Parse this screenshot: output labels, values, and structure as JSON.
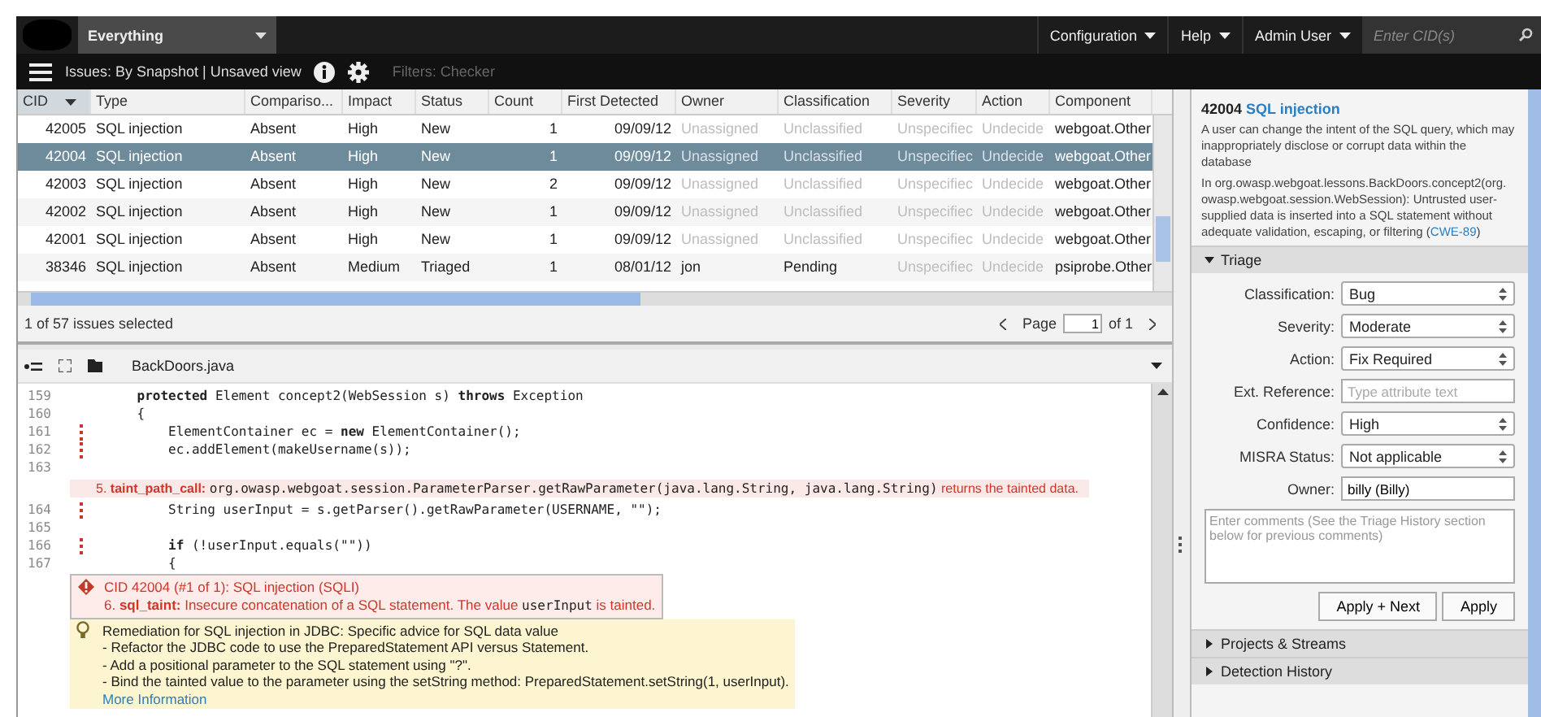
{
  "topbar": {
    "view": "Everything",
    "menus": [
      "Configuration",
      "Help",
      "Admin User"
    ],
    "search": {
      "placeholder": "Enter CID(s)"
    }
  },
  "toolbar": {
    "view_title": "Issues: By Snapshot | Unsaved view",
    "filters": "Filters: Checker"
  },
  "table": {
    "columns": [
      {
        "label": "CID",
        "sorted": true
      },
      {
        "label": "Type",
        "sorted": false
      },
      {
        "label": "Compariso...",
        "sorted": false
      },
      {
        "label": "Impact",
        "sorted": false
      },
      {
        "label": "Status",
        "sorted": false
      },
      {
        "label": "Count",
        "sorted": false
      },
      {
        "label": "First Detected",
        "sorted": false
      },
      {
        "label": "Owner",
        "sorted": false
      },
      {
        "label": "Classification",
        "sorted": false
      },
      {
        "label": "Severity",
        "sorted": false
      },
      {
        "label": "Action",
        "sorted": false
      },
      {
        "label": "Component",
        "sorted": false
      }
    ],
    "rows": [
      {
        "selected": false,
        "cells": [
          "42005",
          "SQL injection",
          "Absent",
          "High",
          "New",
          "1",
          "09/09/12",
          "Unassigned",
          "Unclassified",
          "Unspecifiec",
          "Undecide",
          "webgoat.Other"
        ],
        "dim": [
          false,
          false,
          false,
          false,
          false,
          false,
          false,
          true,
          true,
          true,
          true,
          false
        ]
      },
      {
        "selected": true,
        "cells": [
          "42004",
          "SQL injection",
          "Absent",
          "High",
          "New",
          "1",
          "09/09/12",
          "Unassigned",
          "Unclassified",
          "Unspecifiec",
          "Undecide",
          "webgoat.Other"
        ],
        "dim": [
          false,
          false,
          false,
          false,
          false,
          false,
          false,
          true,
          true,
          true,
          true,
          false
        ]
      },
      {
        "selected": false,
        "cells": [
          "42003",
          "SQL injection",
          "Absent",
          "High",
          "New",
          "2",
          "09/09/12",
          "Unassigned",
          "Unclassified",
          "Unspecifiec",
          "Undecide",
          "webgoat.Other"
        ],
        "dim": [
          false,
          false,
          false,
          false,
          false,
          false,
          false,
          true,
          true,
          true,
          true,
          false
        ]
      },
      {
        "selected": false,
        "cells": [
          "42002",
          "SQL injection",
          "Absent",
          "High",
          "New",
          "1",
          "09/09/12",
          "Unassigned",
          "Unclassified",
          "Unspecifiec",
          "Undecide",
          "webgoat.Other"
        ],
        "dim": [
          false,
          false,
          false,
          false,
          false,
          false,
          false,
          true,
          true,
          true,
          true,
          false
        ]
      },
      {
        "selected": false,
        "cells": [
          "42001",
          "SQL injection",
          "Absent",
          "High",
          "New",
          "1",
          "09/09/12",
          "Unassigned",
          "Unclassified",
          "Unspecifiec",
          "Undecide",
          "webgoat.Other"
        ],
        "dim": [
          false,
          false,
          false,
          false,
          false,
          false,
          false,
          true,
          true,
          true,
          true,
          false
        ]
      },
      {
        "selected": false,
        "cells": [
          "38346",
          "SQL injection",
          "Absent",
          "Medium",
          "Triaged",
          "1",
          "08/01/12",
          "jon",
          "Pending",
          "Unspecifiec",
          "Undecide",
          "psiprobe.Other"
        ],
        "dim": [
          false,
          false,
          false,
          false,
          false,
          false,
          false,
          false,
          false,
          true,
          true,
          false
        ]
      }
    ],
    "selection_status": "1 of 57 issues selected",
    "pager": {
      "label": "Page",
      "value": "1",
      "of": "of 1"
    }
  },
  "source": {
    "file": "BackDoors.java",
    "items": [
      {
        "kind": "line",
        "number": "159",
        "marked": false,
        "code": "    **protected** Element concept2(WebSession s) **throws** Exception"
      },
      {
        "kind": "line",
        "number": "160",
        "marked": false,
        "code": "    {"
      },
      {
        "kind": "line",
        "number": "161",
        "marked": true,
        "code": "        ElementContainer ec = **new** ElementContainer();"
      },
      {
        "kind": "line",
        "number": "162",
        "marked": true,
        "code": "        ec.addElement(makeUsername(s));"
      },
      {
        "kind": "line",
        "number": "163",
        "marked": false
      },
      {
        "kind": "event",
        "step": "5.",
        "tag": "taint_path_call:",
        "code": "org.owasp.webgoat.session.ParameterParser.getRawParameter(java.lang.String, java.lang.String)",
        "tail": "returns the tainted data."
      },
      {
        "kind": "line",
        "number": "164",
        "marked": true,
        "code": "        String userInput = s.getParser().getRawParameter(USERNAME, \"\");"
      },
      {
        "kind": "line",
        "number": "165",
        "marked": false
      },
      {
        "kind": "line",
        "number": "166",
        "marked": true,
        "code": "        **if** (!userInput.equals(\"\"))"
      },
      {
        "kind": "line",
        "number": "167",
        "marked": false,
        "code": "        {"
      },
      {
        "kind": "issue",
        "title": "CID 42004 (#1 of 1): SQL injection (SQLI)",
        "step": "6.",
        "tag": "sql_taint:",
        "text": "Insecure concatenation of a SQL statement. The value",
        "code": "userInput",
        "tail": "is tainted."
      },
      {
        "kind": "remedy",
        "title": "Remediation for SQL injection in JDBC: Specific advice for SQL data value",
        "lines": [
          "- Refactor the JDBC code to use the PreparedStatement API versus Statement.",
          "- Add a positional parameter to the SQL statement using \"?\".",
          "- Bind the tainted value to the parameter using the setString method: PreparedStatement.setString(1, userInput)."
        ],
        "link": "More Information"
      }
    ]
  },
  "details": {
    "cid": "42004",
    "type": "SQL injection",
    "description": "A user can change the intent of the SQL query, which may inappropriately disclose or corrupt data within the database",
    "detail": "In org.owasp.webgoat.lessons.BackDoors.concept2(org. owasp.webgoat.session.WebSession): Untrusted user-supplied data is inserted into a SQL statement without adequate validation, escaping, or filtering (",
    "cwe": "CWE-89",
    "detail_end": ")"
  },
  "triage": {
    "title": "Triage",
    "expanded": true,
    "fields": [
      {
        "kind": "select",
        "label": "Classification:",
        "value": "Bug"
      },
      {
        "kind": "select",
        "label": "Severity:",
        "value": "Moderate"
      },
      {
        "kind": "select",
        "label": "Action:",
        "value": "Fix Required"
      },
      {
        "kind": "text",
        "label": "Ext. Reference:",
        "placeholder": "Type attribute text"
      },
      {
        "kind": "select",
        "label": "Confidence:",
        "value": "High"
      },
      {
        "kind": "select",
        "label": "MISRA Status:",
        "value": "Not applicable"
      },
      {
        "kind": "text",
        "label": "Owner:",
        "value": "billy (Billy)"
      }
    ],
    "comments": {
      "placeholder": "Enter comments (See the Triage History section below for previous comments)"
    },
    "buttons": [
      "Apply + Next",
      "Apply"
    ]
  },
  "sections": [
    {
      "title": "Projects & Streams",
      "expanded": false
    },
    {
      "title": "Detection History",
      "expanded": false
    }
  ]
}
